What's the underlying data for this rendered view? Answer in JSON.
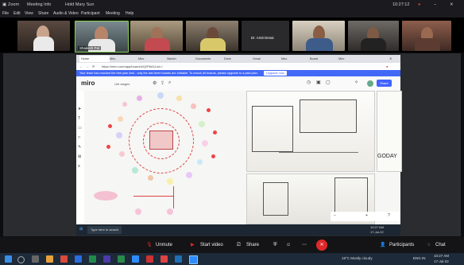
{
  "zoom": {
    "title_app": "Zoom",
    "title_meeting": "Meeting Info",
    "title_audio": "Hold Mary Sun",
    "clock": "10:27:12",
    "menu": [
      "File",
      "Edit",
      "View",
      "Share",
      "Audio & Video",
      "Participant",
      "Meeting",
      "Help"
    ],
    "participants": [
      {
        "name": ""
      },
      {
        "name": "Shailesh Pal"
      },
      {
        "name": ""
      },
      {
        "name": ""
      },
      {
        "name": ""
      },
      {
        "name": "Dr. Amit Desai"
      },
      {
        "name": ""
      },
      {
        "name": ""
      },
      {
        "name": ""
      }
    ],
    "controls": {
      "unmute": "Unmute",
      "start_video": "Start video",
      "share": "Share",
      "participants": "Participants",
      "chat": "Chat"
    }
  },
  "browser": {
    "address": "https://miro.com/app/board/uXjVP6A1LwI=/",
    "info": "Your team has reached the free plan limit - only the last three boards are editable. To unlock all boards, please upgrade to a paid plan.",
    "info_button": "Upgrade now",
    "tabs": [
      "Home",
      "Miro",
      "Miro",
      "Sketch",
      "Documents",
      "Drive",
      "Gmail",
      "Miro",
      "Board",
      "Miro"
    ],
    "board_name": "Life stages",
    "miro_logo": "miro",
    "share_button": "Share",
    "canvas_label": "GODAY",
    "taskbar_search": "Type here to search",
    "taskbar_time": "10:27 AM",
    "taskbar_date": "17-Jul-22"
  },
  "windows": {
    "weather": "19°C Mostly cloudy",
    "time": "10:27 AM",
    "date": "17-Jul-22",
    "lang": "ENG IN"
  },
  "colors": {
    "zoom_red": "#e02828",
    "miro_blue": "#4262ff",
    "info_blue": "#4268f6"
  }
}
